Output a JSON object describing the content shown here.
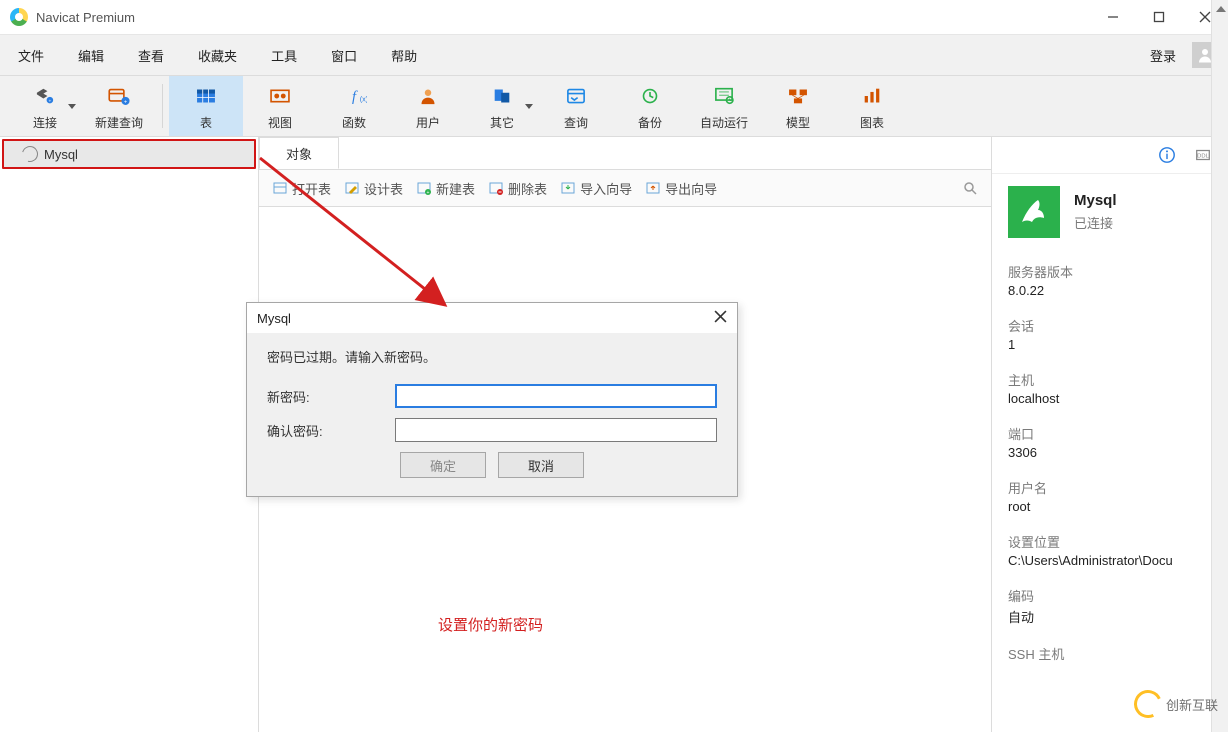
{
  "window": {
    "title": "Navicat Premium"
  },
  "menu": {
    "items": [
      "文件",
      "编辑",
      "查看",
      "收藏夹",
      "工具",
      "窗口",
      "帮助"
    ],
    "login": "登录"
  },
  "toolbar": {
    "items": [
      {
        "id": "connection",
        "label": "连接",
        "caret": true
      },
      {
        "id": "new-query",
        "label": "新建查询"
      },
      {
        "id": "table",
        "label": "表",
        "active": true
      },
      {
        "id": "view",
        "label": "视图"
      },
      {
        "id": "function",
        "label": "函数"
      },
      {
        "id": "user",
        "label": "用户"
      },
      {
        "id": "other",
        "label": "其它",
        "caret": true
      },
      {
        "id": "query",
        "label": "查询"
      },
      {
        "id": "backup",
        "label": "备份"
      },
      {
        "id": "automation",
        "label": "自动运行"
      },
      {
        "id": "model",
        "label": "模型"
      },
      {
        "id": "chart",
        "label": "图表"
      }
    ]
  },
  "left": {
    "connection_name": "Mysql"
  },
  "objtab": {
    "label": "对象"
  },
  "subtoolbar": {
    "items": [
      "打开表",
      "设计表",
      "新建表",
      "删除表",
      "导入向导",
      "导出向导"
    ]
  },
  "right": {
    "conn_name": "Mysql",
    "status": "已连接",
    "props": [
      {
        "label": "服务器版本",
        "value": "8.0.22"
      },
      {
        "label": "会话",
        "value": "1"
      },
      {
        "label": "主机",
        "value": "localhost"
      },
      {
        "label": "端口",
        "value": "3306"
      },
      {
        "label": "用户名",
        "value": "root"
      },
      {
        "label": "设置位置",
        "value": "C:\\Users\\Administrator\\Docu"
      },
      {
        "label": "编码",
        "value": "自动"
      },
      {
        "label": "SSH 主机",
        "value": ""
      }
    ]
  },
  "dialog": {
    "title": "Mysql",
    "message": "密码已过期。请输入新密码。",
    "new_password_label": "新密码:",
    "confirm_password_label": "确认密码:",
    "ok": "确定",
    "cancel": "取消"
  },
  "annotations": {
    "set_password": "设置你的新密码",
    "brand": "创新互联"
  }
}
